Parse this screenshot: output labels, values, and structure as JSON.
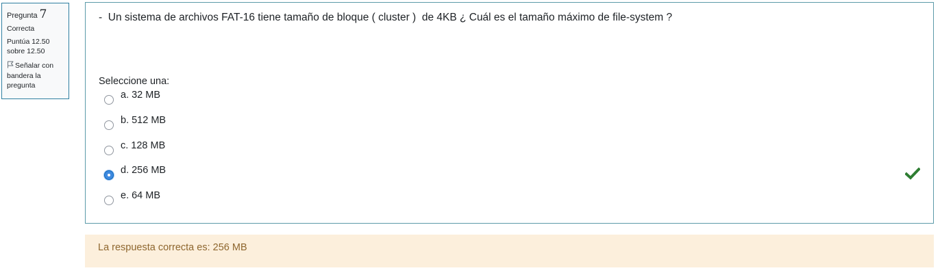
{
  "info": {
    "question_label": "Pregunta",
    "question_number": "7",
    "state": "Correcta",
    "grade_line1": "Puntúa 12.50",
    "grade_line2": "sobre 12.50",
    "flag_line1": "Señalar con",
    "flag_line2": "bandera la",
    "flag_line3": "pregunta",
    "flag_icon": "flag-outline-icon",
    "border_color": "#2d7ea0"
  },
  "question": {
    "text": "-  Un sistema de archivos FAT-16 tiene tamaño de bloque ( cluster )  de 4KB ¿ Cuál es el tamaño máximo de file-system ?",
    "prompt": "Seleccione una:",
    "answers": [
      {
        "label": "a. 32 MB",
        "selected": false
      },
      {
        "label": "b. 512 MB",
        "selected": false
      },
      {
        "label": "c. 128 MB",
        "selected": false
      },
      {
        "label": "d. 256 MB",
        "selected": true
      },
      {
        "label": "e. 64 MB",
        "selected": false
      }
    ],
    "correct_icon": "checkmark-icon",
    "correct_color": "#2e7d32"
  },
  "feedback": {
    "text": "La respuesta correcta es: 256 MB",
    "background": "#fcefdc",
    "color": "#8e662e"
  }
}
